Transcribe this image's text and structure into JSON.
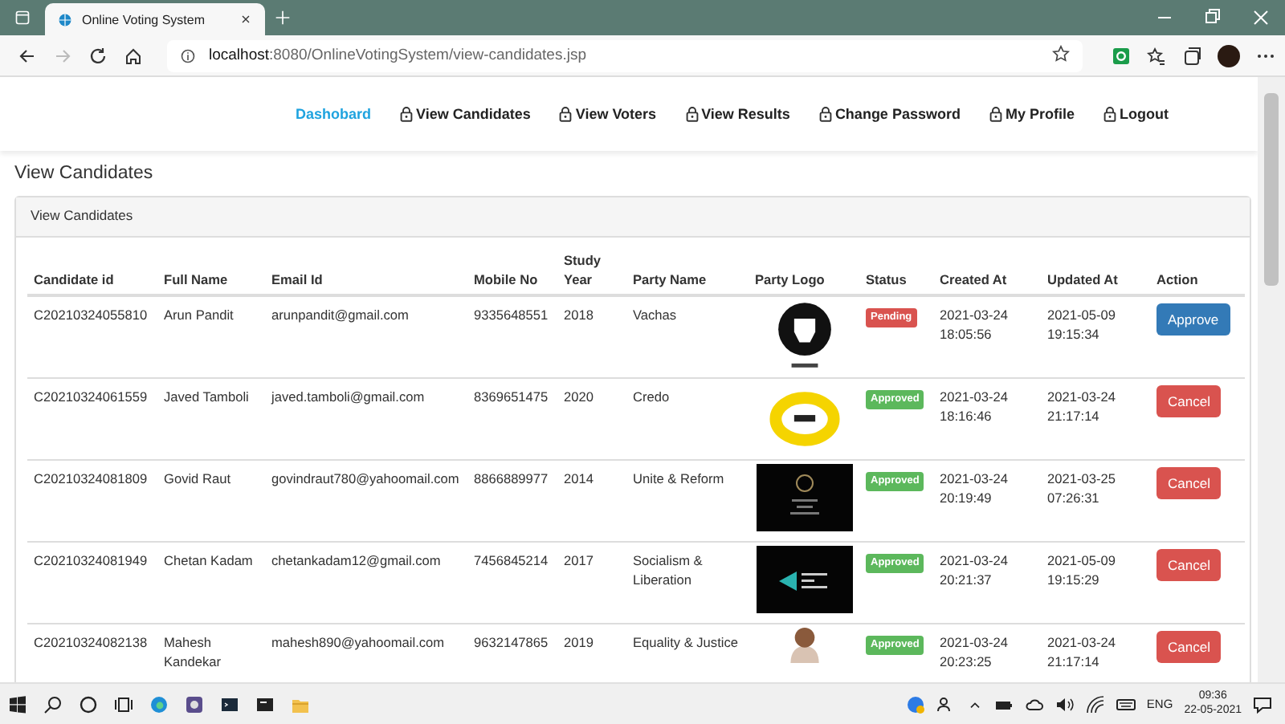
{
  "browser": {
    "tab_title": "Online Voting System",
    "url_host": "localhost",
    "url_path": ":8080/OnlineVotingSystem/view-candidates.jsp"
  },
  "nav": [
    {
      "label": "Dashobard",
      "selected": true,
      "lock": false
    },
    {
      "label": "View Candidates",
      "selected": false,
      "lock": true
    },
    {
      "label": "View Voters",
      "selected": false,
      "lock": true
    },
    {
      "label": "View Results",
      "selected": false,
      "lock": true
    },
    {
      "label": "Change Password",
      "selected": false,
      "lock": true
    },
    {
      "label": "My Profile",
      "selected": false,
      "lock": true
    },
    {
      "label": "Logout",
      "selected": false,
      "lock": true
    }
  ],
  "page_title": "View Candidates",
  "card": {
    "header": "View Candidates",
    "columns": [
      "Candidate id",
      "Full Name",
      "Email Id",
      "Mobile No",
      "Study Year",
      "Party Name",
      "Party Logo",
      "Status",
      "Created At",
      "Updated At",
      "Action"
    ],
    "rows": [
      {
        "candidate_id": "C20210324055810",
        "full_name": "Arun Pandit",
        "email": "arunpandit@gmail.com",
        "mobile": "9335648551",
        "study_year": "2018",
        "party_name": "Vachas",
        "logo": {
          "kind": "fist"
        },
        "status": {
          "label": "Pending",
          "kind": "pending"
        },
        "created_at": "2021-03-24 18:05:56",
        "updated_at": "2021-05-09 19:15:34",
        "action": {
          "label": "Approve",
          "kind": "approve"
        }
      },
      {
        "candidate_id": "C20210324061559",
        "full_name": "Javed Tamboli",
        "email": "javed.tamboli@gmail.com",
        "mobile": "8369651475",
        "study_year": "2020",
        "party_name": "Credo",
        "logo": {
          "kind": "ring"
        },
        "status": {
          "label": "Approved",
          "kind": "approved"
        },
        "created_at": "2021-03-24 18:16:46",
        "updated_at": "2021-03-24 21:17:14",
        "action": {
          "label": "Cancel",
          "kind": "cancel"
        }
      },
      {
        "candidate_id": "C20210324081809",
        "full_name": "Govid Raut",
        "email": "govindraut780@yahoomail.com",
        "mobile": "8866889977",
        "study_year": "2014",
        "party_name": "Unite & Reform",
        "logo": {
          "kind": "dark-circle"
        },
        "status": {
          "label": "Approved",
          "kind": "approved"
        },
        "created_at": "2021-03-24 20:19:49",
        "updated_at": "2021-03-25 07:26:31",
        "action": {
          "label": "Cancel",
          "kind": "cancel"
        }
      },
      {
        "candidate_id": "C20210324081949",
        "full_name": "Chetan Kadam",
        "email": "chetankadam12@gmail.com",
        "mobile": "7456845214",
        "study_year": "2017",
        "party_name": "Socialism & Liberation",
        "logo": {
          "kind": "dark-triangle"
        },
        "status": {
          "label": "Approved",
          "kind": "approved"
        },
        "created_at": "2021-03-24 20:21:37",
        "updated_at": "2021-05-09 19:15:29",
        "action": {
          "label": "Cancel",
          "kind": "cancel"
        }
      },
      {
        "candidate_id": "C20210324082138",
        "full_name": "Mahesh Kandekar",
        "email": "mahesh890@yahoomail.com",
        "mobile": "9632147865",
        "study_year": "2019",
        "party_name": "Equality & Justice",
        "logo": {
          "kind": "portrait"
        },
        "status": {
          "label": "Approved",
          "kind": "approved"
        },
        "created_at": "2021-03-24 20:23:25",
        "updated_at": "2021-03-24 21:17:14",
        "action": {
          "label": "Cancel",
          "kind": "cancel"
        }
      }
    ]
  },
  "taskbar": {
    "language": "ENG",
    "time": "09:36",
    "date": "22-05-2021"
  }
}
